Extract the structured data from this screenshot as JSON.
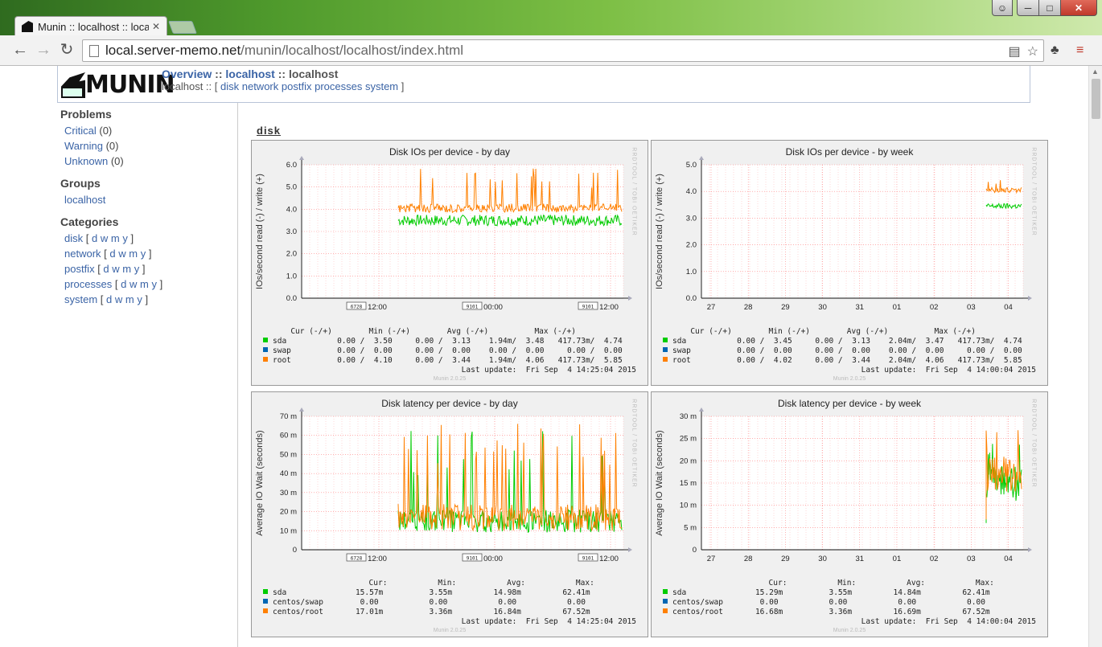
{
  "browser": {
    "tab_title": "Munin :: localhost :: localhost",
    "url_host": "local.server-memo.net",
    "url_path": "/munin/localhost/localhost/index.html",
    "accent": "#4f9a2c"
  },
  "header": {
    "logo_text": "MUNIN",
    "crumb_overview": "Overview",
    "crumb_sep1": " :: ",
    "crumb_group": "localhost",
    "crumb_sep2": " :: ",
    "crumb_host": "localhost",
    "sub_host": "localhost",
    "sub_sep": " :: [ ",
    "sub_links": [
      "disk",
      "network",
      "postfix",
      "processes",
      "system"
    ],
    "sub_end": " ]"
  },
  "sidebar": {
    "problems_heading": "Problems",
    "problems": [
      {
        "label": "Critical",
        "count": "(0)"
      },
      {
        "label": "Warning",
        "count": "(0)"
      },
      {
        "label": "Unknown",
        "count": "(0)"
      }
    ],
    "groups_heading": "Groups",
    "groups": [
      "localhost"
    ],
    "categories_heading": "Categories",
    "categories": [
      "disk",
      "network",
      "postfix",
      "processes",
      "system"
    ],
    "period_links": [
      "d",
      "w",
      "m",
      "y"
    ]
  },
  "section": {
    "title": "disk"
  },
  "graphs": [
    {
      "title": "Disk IOs per device - by day",
      "ylabel": "IOs/second read (-) / write (+)",
      "header_row": "      Cur (-/+)        Min (-/+)        Avg (-/+)          Max (-/+)",
      "rows": [
        {
          "name": "sda ",
          "values": "          0.00 /  3.50     0.00 /  3.13    1.94m/  3.48   417.73m/  4.74",
          "color": "#00cc00"
        },
        {
          "name": "swap",
          "values": "          0.00 /  0.00     0.00 /  0.00    0.00 /  0.00     0.00 /  0.00",
          "color": "#0066b3"
        },
        {
          "name": "root",
          "values": "          0.00 /  4.10     0.00 /  3.44    1.94m/  4.06   417.73m/  5.85",
          "color": "#ff8000"
        }
      ],
      "last_update": "Last update:  Fri Sep  4 14:25:04 2015",
      "version": "Munin 2.0.25"
    },
    {
      "title": "Disk IOs per device - by week",
      "ylabel": "IOs/second read (-) / write (+)",
      "header_row": "      Cur (-/+)        Min (-/+)        Avg (-/+)          Max (-/+)",
      "rows": [
        {
          "name": "sda ",
          "values": "          0.00 /  3.45     0.00 /  3.13    2.04m/  3.47   417.73m/  4.74",
          "color": "#00cc00"
        },
        {
          "name": "swap",
          "values": "          0.00 /  0.00     0.00 /  0.00    0.00 /  0.00     0.00 /  0.00",
          "color": "#0066b3"
        },
        {
          "name": "root",
          "values": "          0.00 /  4.02     0.00 /  3.44    2.04m/  4.06   417.73m/  5.85",
          "color": "#ff8000"
        }
      ],
      "last_update": "Last update:  Fri Sep  4 14:00:04 2015",
      "version": "Munin 2.0.25"
    },
    {
      "title": "Disk latency per device - by day",
      "ylabel": "Average IO Wait (seconds)",
      "header_row": "                       Cur:           Min:           Avg:           Max:",
      "rows": [
        {
          "name": "sda        ",
          "values": "       15.57m          3.55m         14.98m         62.41m",
          "color": "#00cc00"
        },
        {
          "name": "centos/swap",
          "values": "        0.00           0.00           0.00           0.00",
          "color": "#0066b3"
        },
        {
          "name": "centos/root",
          "values": "       17.01m          3.36m         16.84m         67.52m",
          "color": "#ff8000"
        }
      ],
      "last_update": "Last update:  Fri Sep  4 14:25:04 2015",
      "version": "Munin 2.0.25"
    },
    {
      "title": "Disk latency per device - by week",
      "ylabel": "Average IO Wait (seconds)",
      "header_row": "                       Cur:           Min:           Avg:           Max:",
      "rows": [
        {
          "name": "sda        ",
          "values": "       15.29m          3.55m         14.84m         62.41m",
          "color": "#00cc00"
        },
        {
          "name": "centos/swap",
          "values": "        0.00           0.00           0.00           0.00",
          "color": "#0066b3"
        },
        {
          "name": "centos/root",
          "values": "       16.68m          3.36m         16.69m         67.52m",
          "color": "#ff8000"
        }
      ],
      "last_update": "Last update:  Fri Sep  4 14:00:04 2015",
      "version": "Munin 2.0.25"
    }
  ],
  "chart_data": [
    {
      "type": "line",
      "title": "Disk IOs per device - by day",
      "ylabel": "IOs/second read (-) / write (+)",
      "ylim": [
        0,
        6
      ],
      "yticks": [
        0,
        1,
        2,
        3,
        4,
        5,
        6
      ],
      "ytick_labels": [
        "0.0",
        "1.0",
        "2.0",
        "3.0",
        "4.0",
        "5.0",
        "6.0"
      ],
      "xtick_labels": [
        {
          "label": "12:00",
          "box": "6728"
        },
        {
          "label": "00:00",
          "box": "9101"
        },
        {
          "label": "12:00",
          "box": "9101"
        }
      ],
      "series": [
        {
          "name": "sda",
          "color": "#00cc00",
          "level": 3.5,
          "jitter": 0.25,
          "spikes": 0
        },
        {
          "name": "swap",
          "color": "#0066b3",
          "level": 0,
          "jitter": 0,
          "spikes": 0
        },
        {
          "name": "root",
          "color": "#ff8000",
          "level": 4.05,
          "jitter": 0.2,
          "spikes": 5.85
        }
      ]
    },
    {
      "type": "line",
      "title": "Disk IOs per device - by week",
      "ylabel": "IOs/second read (-) / write (+)",
      "ylim": [
        0,
        5
      ],
      "yticks": [
        0,
        1,
        2,
        3,
        4,
        5
      ],
      "ytick_labels": [
        "0.0",
        "1.0",
        "2.0",
        "3.0",
        "4.0",
        "5.0"
      ],
      "xtick_labels": [
        "27",
        "28",
        "29",
        "30",
        "31",
        "01",
        "02",
        "03",
        "04"
      ],
      "series": [
        {
          "name": "sda",
          "color": "#00cc00",
          "level": 3.45,
          "jitter": 0.1,
          "spikes": 0
        },
        {
          "name": "swap",
          "color": "#0066b3",
          "level": 0,
          "jitter": 0,
          "spikes": 0
        },
        {
          "name": "root",
          "color": "#ff8000",
          "level": 4.05,
          "jitter": 0.1,
          "spikes": 4.5
        }
      ]
    },
    {
      "type": "line",
      "title": "Disk latency per device - by day",
      "ylabel": "Average IO Wait (seconds)",
      "ylim": [
        0,
        70
      ],
      "yticks": [
        0,
        10,
        20,
        30,
        40,
        50,
        60,
        70
      ],
      "ytick_labels": [
        "0",
        "10 m",
        "20 m",
        "30 m",
        "40 m",
        "50 m",
        "60 m",
        "70 m"
      ],
      "xtick_labels": [
        {
          "label": "12:00",
          "box": "6728"
        },
        {
          "label": "00:00",
          "box": "9101"
        },
        {
          "label": "12:00",
          "box": "9101"
        }
      ],
      "series": [
        {
          "name": "sda",
          "color": "#00cc00",
          "level": 15,
          "jitter": 6,
          "spikes": 62.41
        },
        {
          "name": "centos/swap",
          "color": "#0066b3",
          "level": 0,
          "jitter": 0,
          "spikes": 0
        },
        {
          "name": "centos/root",
          "color": "#ff8000",
          "level": 17,
          "jitter": 7,
          "spikes": 67.52
        }
      ]
    },
    {
      "type": "line",
      "title": "Disk latency per device - by week",
      "ylabel": "Average IO Wait (seconds)",
      "ylim": [
        0,
        30
      ],
      "yticks": [
        0,
        5,
        10,
        15,
        20,
        25,
        30
      ],
      "ytick_labels": [
        "0",
        "5 m",
        "10 m",
        "15 m",
        "20 m",
        "25 m",
        "30 m"
      ],
      "xtick_labels": [
        "27",
        "28",
        "29",
        "30",
        "31",
        "01",
        "02",
        "03",
        "04"
      ],
      "series": [
        {
          "name": "sda",
          "color": "#00cc00",
          "level": 15,
          "jitter": 4,
          "spikes": 25
        },
        {
          "name": "centos/swap",
          "color": "#0066b3",
          "level": 0,
          "jitter": 0,
          "spikes": 0
        },
        {
          "name": "centos/root",
          "color": "#ff8000",
          "level": 17,
          "jitter": 4,
          "spikes": 28
        }
      ]
    }
  ]
}
